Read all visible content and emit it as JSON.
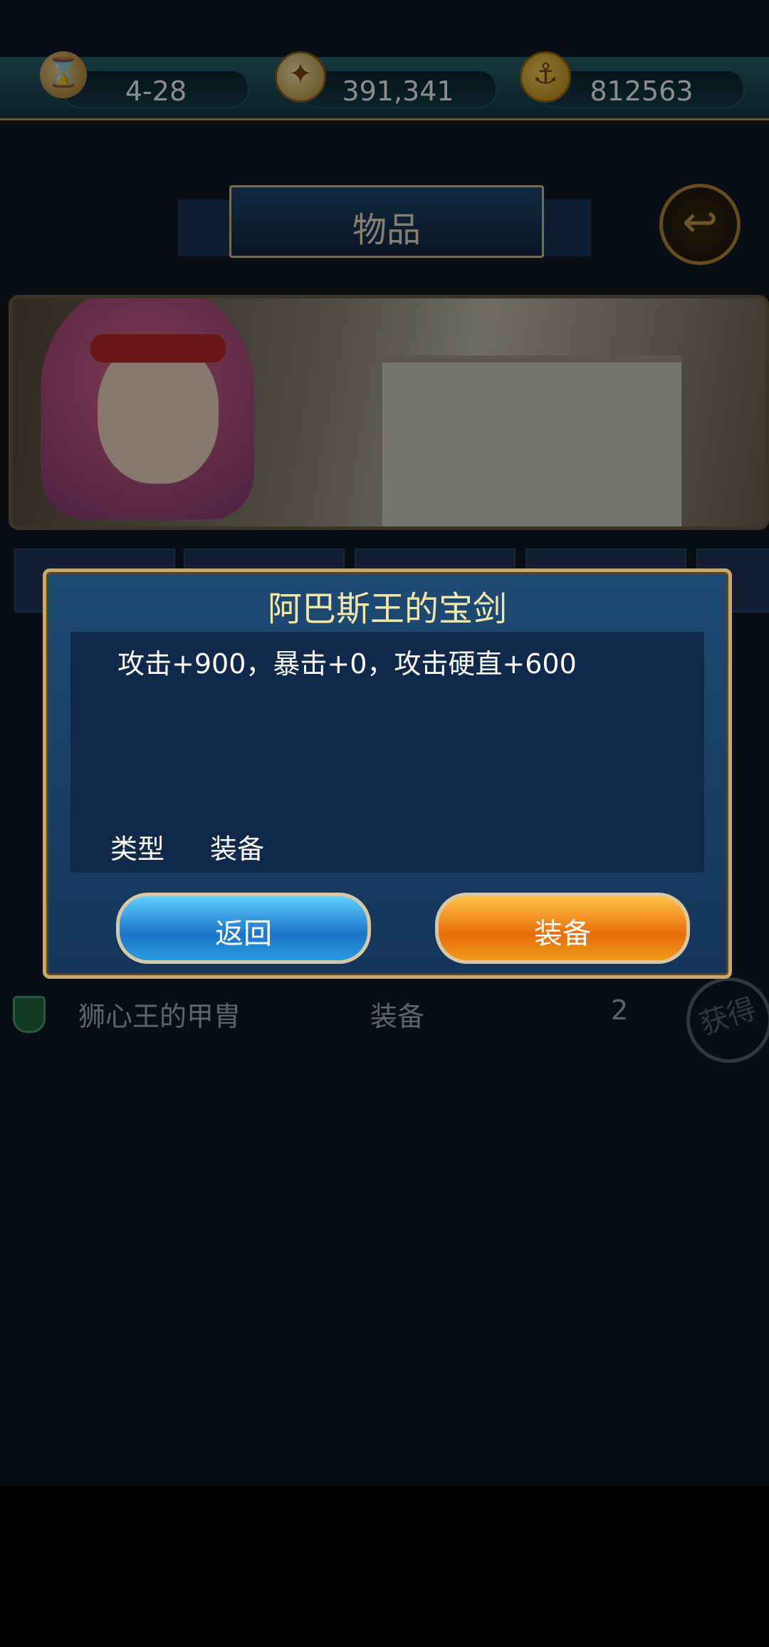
{
  "topbar": {
    "date": "4-28",
    "compass_value": "391,341",
    "gold_value": "812563",
    "icons": [
      "hourglass-icon",
      "compass-icon",
      "anchor-coin-icon"
    ]
  },
  "header": {
    "title": "物品"
  },
  "list": {
    "rows": [
      {
        "name": "狮心王的甲胄",
        "type": "装备",
        "qty": "2",
        "stamp": "获得"
      }
    ]
  },
  "modal": {
    "title": "阿巴斯王的宝剑",
    "description": "攻击+900，暴击+0，攻击硬直+600",
    "type_label": "类型",
    "type_value": "装备",
    "back_button": "返回",
    "equip_button": "装备"
  },
  "colors": {
    "title_gold": "#f3e7a8",
    "blue_button": "#1b74c8",
    "orange_button": "#e86c0a"
  }
}
